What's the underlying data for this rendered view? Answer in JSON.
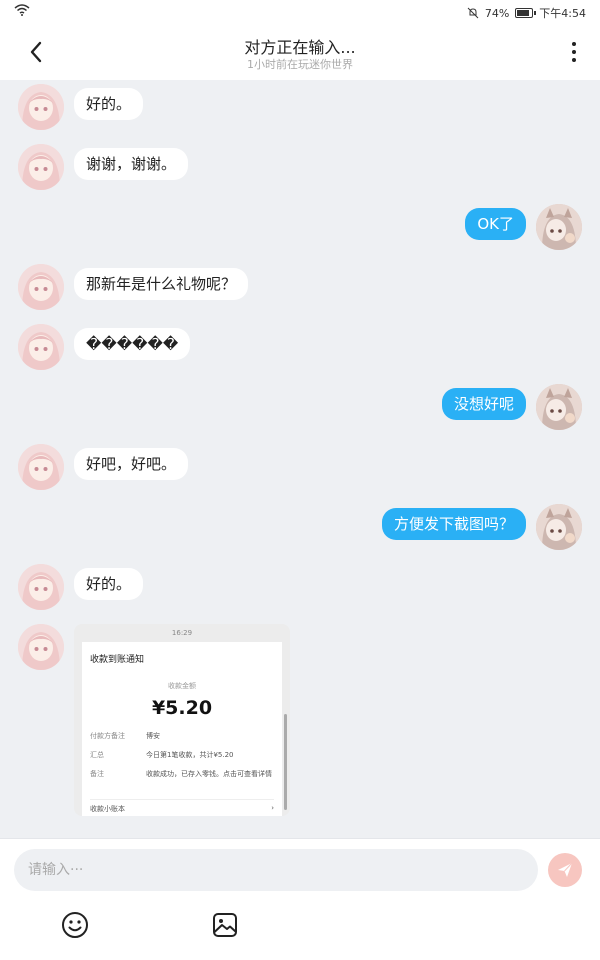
{
  "status_bar": {
    "battery_text": "74%",
    "time": "下午4:54"
  },
  "header": {
    "title": "对方正在输入...",
    "subtitle": "1小时前在玩迷你世界"
  },
  "messages": [
    {
      "side": "left",
      "text": "好的。"
    },
    {
      "side": "left",
      "text": "谢谢，谢谢。"
    },
    {
      "side": "right",
      "text": "OK了"
    },
    {
      "side": "left",
      "text": "那新年是什么礼物呢？"
    },
    {
      "side": "left",
      "text": "������"
    },
    {
      "side": "right",
      "text": "没想好呢"
    },
    {
      "side": "left",
      "text": "好吧，好吧。"
    },
    {
      "side": "right",
      "text": "方便发下截图吗？"
    },
    {
      "side": "left",
      "text": "好的。"
    }
  ],
  "screenshot": {
    "time": "16:29",
    "heading": "收款到账通知",
    "amount_label": "收款金额",
    "amount": "¥5.20",
    "rows": [
      {
        "key": "付款方备注",
        "value": "博安"
      },
      {
        "key": "汇总",
        "value": "今日第1笔收款，共计¥5.20"
      },
      {
        "key": "备注",
        "value": "收款成功，已存入零钱。点击可查看详情"
      }
    ],
    "footer": "收款小账本",
    "footer_arrow": "›"
  },
  "input": {
    "placeholder": "请输入···"
  },
  "colors": {
    "accent": "#2ab0f5",
    "background": "#eef0f3",
    "send": "#f7c6c0"
  },
  "icons": {
    "back": "chevron-left-icon",
    "more": "more-vertical-icon",
    "send": "paper-plane-icon",
    "emoji": "smiley-icon",
    "image": "image-icon"
  }
}
